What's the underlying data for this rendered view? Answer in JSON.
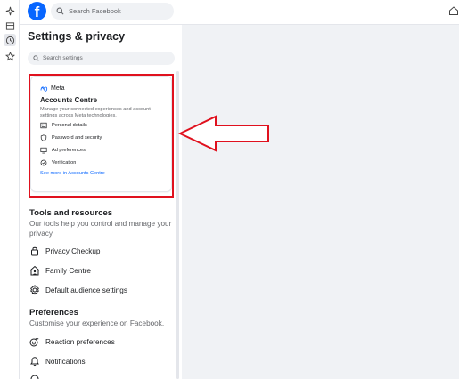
{
  "browser_strip": {
    "icons": [
      "sparkle-icon",
      "tab-icon",
      "history-icon",
      "star-icon"
    ]
  },
  "topbar": {
    "logo_letter": "f",
    "search_placeholder": "Search Facebook"
  },
  "settings_panel": {
    "title": "Settings & privacy",
    "search_placeholder": "Search settings",
    "accounts_centre": {
      "brand": "Meta",
      "title": "Accounts Centre",
      "description": "Manage your connected experiences and account settings across Meta technologies.",
      "items": [
        {
          "label": "Personal details",
          "icon": "id-card-icon"
        },
        {
          "label": "Password and security",
          "icon": "shield-icon"
        },
        {
          "label": "Ad preferences",
          "icon": "monitor-icon"
        },
        {
          "label": "Verification",
          "icon": "check-circle-icon"
        }
      ],
      "link": "See more in Accounts Centre"
    },
    "tools": {
      "title": "Tools and resources",
      "description": "Our tools help you control and manage your privacy.",
      "items": [
        {
          "label": "Privacy Checkup",
          "icon": "lock-icon"
        },
        {
          "label": "Family Centre",
          "icon": "family-icon"
        },
        {
          "label": "Default audience settings",
          "icon": "gear-icon"
        }
      ]
    },
    "preferences": {
      "title": "Preferences",
      "description": "Customise your experience on Facebook.",
      "items": [
        {
          "label": "Reaction preferences",
          "icon": "reaction-icon"
        },
        {
          "label": "Notifications",
          "icon": "bell-icon"
        }
      ]
    }
  },
  "annotation": {
    "highlight_color": "#e0111e",
    "arrow_color": "#e0111e"
  }
}
